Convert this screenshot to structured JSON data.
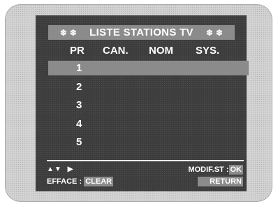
{
  "title": {
    "star": "❄ ❄",
    "text": "LISTE STATIONS TV"
  },
  "columns": [
    "PR",
    "CAN.",
    "NOM",
    "SYS."
  ],
  "rows": [
    {
      "pr": "1",
      "selected": true
    },
    {
      "pr": "2",
      "selected": false
    },
    {
      "pr": "3",
      "selected": false
    },
    {
      "pr": "4",
      "selected": false
    },
    {
      "pr": "5",
      "selected": false
    }
  ],
  "footer": {
    "nav_up_down": "▲▼",
    "nav_right": "▶",
    "effacer_label": "EFFACE :",
    "clear_key": "CLEAR",
    "modif_label": "MODIF.ST :",
    "ok_key": "OK",
    "return_key": "RETURN"
  },
  "colors": {
    "osd_background": "#3f3f3f",
    "highlight": "#8b8b8b",
    "text": "#ffffff",
    "frame": "#cfcfcf"
  }
}
